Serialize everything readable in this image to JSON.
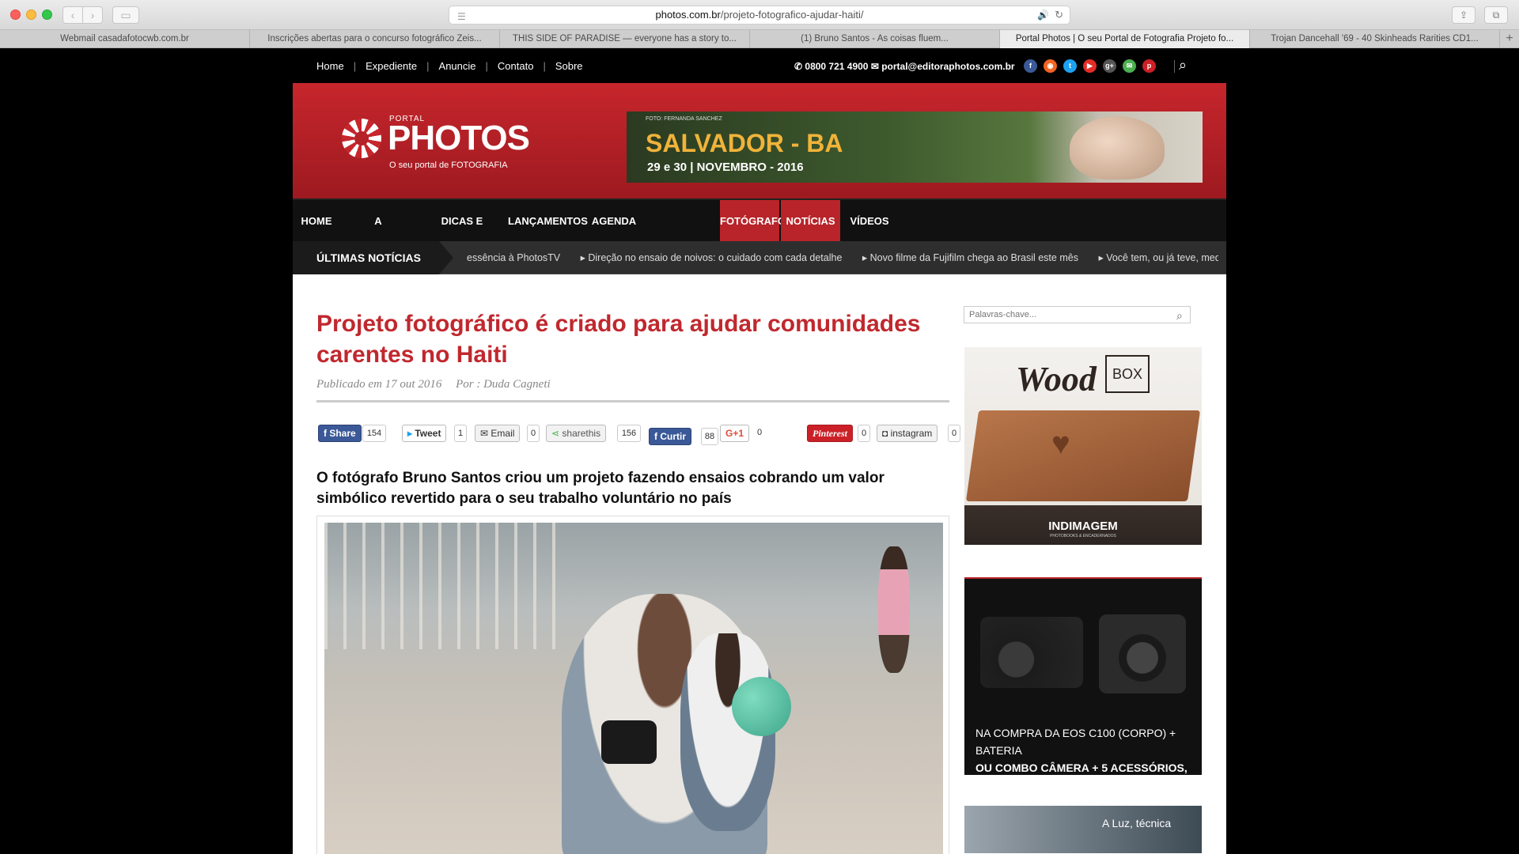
{
  "browser": {
    "url_domain": "photos.com.br",
    "url_path": "/projeto-fotografico-ajudar-haiti/",
    "tabs": [
      {
        "label": "Webmail casadafotocwb.com.br"
      },
      {
        "label": "Inscrições abertas para o concurso fotográfico Zeis..."
      },
      {
        "label": "THIS SIDE OF PARADISE — everyone has a story to..."
      },
      {
        "label": "(1) Bruno Santos - As coisas fluem..."
      },
      {
        "label": "Portal Photos | O seu Portal de Fotografia Projeto fo..."
      },
      {
        "label": "Trojan Dancehall '69 - 40 Skinheads Rarities CD1..."
      }
    ],
    "active_tab": 4
  },
  "topbar": {
    "links": [
      "Home",
      "Expediente",
      "Anuncie",
      "Contato",
      "Sobre"
    ],
    "phone": "0800 721 4900",
    "email": "portal@editoraphotos.com.br",
    "socials": [
      {
        "icon": "facebook-icon",
        "glyph": "f",
        "color": "#3b5998"
      },
      {
        "icon": "rss-icon",
        "glyph": "◉",
        "color": "#f26522"
      },
      {
        "icon": "twitter-icon",
        "glyph": "t",
        "color": "#1da1f2"
      },
      {
        "icon": "youtube-icon",
        "glyph": "▶",
        "color": "#e52d27"
      },
      {
        "icon": "google-plus-icon",
        "glyph": "g+",
        "color": "#555555"
      },
      {
        "icon": "email-icon",
        "glyph": "✉",
        "color": "#4caf50"
      },
      {
        "icon": "pinterest-icon",
        "glyph": "p",
        "color": "#cb2027"
      }
    ]
  },
  "header": {
    "logo_portal": "PORTAL",
    "logo_photos": "PHOTOS",
    "logo_tagline": "O seu portal de FOTOGRAFIA",
    "banner": {
      "credit": "FOTO: FERNANDA SANCHEZ",
      "city": "SALVADOR - BA",
      "date": "29 e 30 | NOVEMBRO - 2016"
    }
  },
  "mainnav": {
    "items": [
      {
        "label": "HOME",
        "highlight": false
      },
      {
        "label": "A FOTOGRAFIA",
        "highlight": false
      },
      {
        "label": "DICAS E TUTORIAIS",
        "highlight": false
      },
      {
        "label": "LANÇAMENTOS",
        "highlight": false
      },
      {
        "label": "AGENDA",
        "highlight": false
      },
      {
        "label": "FOTÓGRAFOS",
        "highlight": true
      },
      {
        "label": "NOTÍCIAS",
        "highlight": true
      },
      {
        "label": "VÍDEOS",
        "highlight": false
      }
    ]
  },
  "ticker": {
    "label": "ÚLTIMAS NOTÍCIAS",
    "items": [
      "essência à PhotosTV",
      "Direção no ensaio de noivos: o cuidado com cada detalhe",
      "Novo filme da Fujifilm chega ao Brasil este mês",
      "Você tem, ou já teve, med"
    ]
  },
  "article": {
    "title": "Projeto fotográfico é criado para ajudar comunidades carentes no Haiti",
    "published": "Publicado em 17 out 2016",
    "author": "Por : Duda Cagneti",
    "lead": "O fotógrafo Bruno Santos criou um projeto fazendo ensaios cobrando um valor simbólico revertido para o seu trabalho voluntário no país",
    "share": {
      "fb_share": "Share",
      "fb_share_count": "154",
      "tweet": "Tweet",
      "tweet_count": "1",
      "email": "Email",
      "email_count": "0",
      "sharethis": "sharethis",
      "sharethis_count": "156",
      "curtir": "Curtir",
      "curtir_count": "88",
      "gplus": "G+1",
      "gplus_count": "0",
      "pinterest": "Pinterest",
      "pinterest_count": "0",
      "instagram": "instagram",
      "instagram_count": "0"
    }
  },
  "sidebar": {
    "search_placeholder": "Palavras-chave...",
    "ad1": {
      "brand": "Wood",
      "box": "BOX",
      "maker": "INDIMAGEM",
      "sub": "PHOTOBOOKS & ENCADERNADOS"
    },
    "ad2": {
      "line1": "NA COMPRA DA EOS C100 (CORPO) + BATERIA",
      "line2": "OU COMBO CÂMERA + 5 ACESSÓRIOS,"
    },
    "ad3": {
      "text": "A Luz, técnica"
    }
  }
}
